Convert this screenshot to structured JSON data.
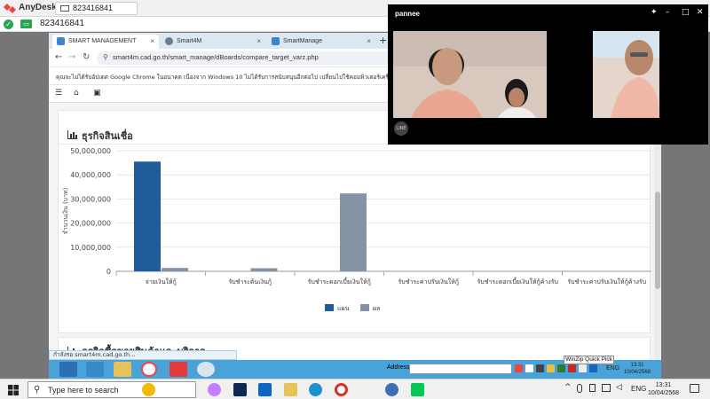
{
  "anydesk": {
    "app_name": "AnyDesk",
    "tab_id": "823416841",
    "address_value": "823416841"
  },
  "browser": {
    "tabs": [
      {
        "label": "SMART MANAGEMENT",
        "active": true
      },
      {
        "label": "Smart4M",
        "active": false
      },
      {
        "label": "SmartManage",
        "active": false
      }
    ],
    "new_tab": "+",
    "url": "smart4m.cad.go.th/smart_manage/dBoards/compare_target_varz.php",
    "info_message": "คุณจะไม่ได้รับอัปเดต Google Chrome ในอนาคต เนื่องจาก Windows 10 ไม่ได้รับการสนับสนุนอีกต่อไป เปลี่ยนไปใช้คอมพิวเตอร์เครื่องใหม่"
  },
  "page": {
    "section_title": "ธุรกิจสินเชื่อ",
    "section2_title": "ธุรกิจซื้อขายสินค้าและบริการ"
  },
  "chart_data": {
    "type": "bar",
    "title": "",
    "ylabel": "จำนวนเงิน (บาท)",
    "xlabel": "",
    "ylim": [
      0,
      50000000
    ],
    "yticks": [
      0,
      10000000,
      20000000,
      30000000,
      40000000,
      50000000
    ],
    "ytick_labels": [
      "0",
      "10,000,000",
      "20,000,000",
      "30,000,000",
      "40,000,000",
      "50,000,000"
    ],
    "grid": true,
    "legend_position": "bottom",
    "categories": [
      "จ่ายเงินให้กู้",
      "รับชำระต้นเงินกู้",
      "รับชำระดอกเบี้ยเงินให้กู้",
      "รับชำระค่าปรับเงินให้กู้",
      "รับชำระดอกเบี้ยเงินให้กู้ค้างรับ",
      "รับชำระค่าปรับเงินให้กู้ค้างรับ"
    ],
    "series": [
      {
        "name": "แผน",
        "color": "#1f5c99",
        "values": [
          45500000,
          0,
          0,
          0,
          0,
          0
        ]
      },
      {
        "name": "ผล",
        "color": "#8493a6",
        "values": [
          1400000,
          1300000,
          32300000,
          0,
          0,
          0
        ]
      }
    ]
  },
  "status_url": "กำลังรอ smart4m.cad.go.th...",
  "remote_taskbar": {
    "address_label": "Address",
    "lang": "ENG",
    "time": "13:31",
    "date": "10/04/2568",
    "tooltip": "WinZip Quick Pick"
  },
  "call": {
    "caller_name": "pannee",
    "badge": "LINE"
  },
  "windows_taskbar": {
    "search_placeholder": "Type here to search",
    "lang": "ENG",
    "time": "13:31",
    "date": "10/04/2568"
  },
  "colors": {
    "accent": "#4aa3d8",
    "plan_bar": "#1f5c99",
    "actual_bar": "#8493a6"
  }
}
